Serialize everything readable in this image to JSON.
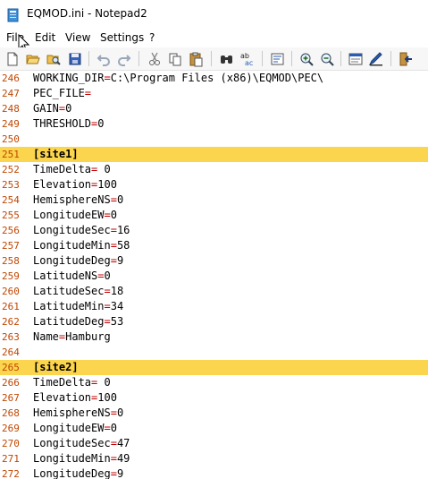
{
  "window": {
    "title": "EQMOD.ini - Notepad2"
  },
  "menu": [
    {
      "label": "File"
    },
    {
      "label": "Edit"
    },
    {
      "label": "View"
    },
    {
      "label": "Settings"
    },
    {
      "label": "?"
    }
  ],
  "toolbar": {
    "buttons": [
      "new-file-icon",
      "open-file-icon",
      "browse-icon",
      "save-icon",
      "undo-icon",
      "redo-icon",
      "cut-icon",
      "copy-icon",
      "paste-icon",
      "find-icon",
      "replace-icon",
      "word-wrap-icon",
      "zoom-in-icon",
      "zoom-out-icon",
      "scheme-icon",
      "customize-scheme-icon",
      "exit-icon"
    ]
  },
  "editor": {
    "lines": [
      {
        "num": "246",
        "key": "WORKING_DIR",
        "eq": "=",
        "val": "C:\\Program Files (x86)\\EQMOD\\PEC\\"
      },
      {
        "num": "247",
        "key": "PEC_FILE",
        "eq": "=",
        "val": ""
      },
      {
        "num": "248",
        "key": "GAIN",
        "eq": "=",
        "val": "0"
      },
      {
        "num": "249",
        "key": "THRESHOLD",
        "eq": "=",
        "val": "0"
      },
      {
        "num": "250",
        "key": "",
        "eq": "",
        "val": ""
      },
      {
        "num": "251",
        "section": "[site1]"
      },
      {
        "num": "252",
        "key": "TimeDelta",
        "eq": "=",
        "val": " 0"
      },
      {
        "num": "253",
        "key": "Elevation",
        "eq": "=",
        "val": "100"
      },
      {
        "num": "254",
        "key": "HemisphereNS",
        "eq": "=",
        "val": "0"
      },
      {
        "num": "255",
        "key": "LongitudeEW",
        "eq": "=",
        "val": "0"
      },
      {
        "num": "256",
        "key": "LongitudeSec",
        "eq": "=",
        "val": "16"
      },
      {
        "num": "257",
        "key": "LongitudeMin",
        "eq": "=",
        "val": "58"
      },
      {
        "num": "258",
        "key": "LongitudeDeg",
        "eq": "=",
        "val": "9"
      },
      {
        "num": "259",
        "key": "LatitudeNS",
        "eq": "=",
        "val": "0"
      },
      {
        "num": "260",
        "key": "LatitudeSec",
        "eq": "=",
        "val": "18"
      },
      {
        "num": "261",
        "key": "LatitudeMin",
        "eq": "=",
        "val": "34"
      },
      {
        "num": "262",
        "key": "LatitudeDeg",
        "eq": "=",
        "val": "53"
      },
      {
        "num": "263",
        "key": "Name",
        "eq": "=",
        "val": "Hamburg"
      },
      {
        "num": "264",
        "key": "",
        "eq": "",
        "val": ""
      },
      {
        "num": "265",
        "section": "[site2]"
      },
      {
        "num": "266",
        "key": "TimeDelta",
        "eq": "=",
        "val": " 0"
      },
      {
        "num": "267",
        "key": "Elevation",
        "eq": "=",
        "val": "100"
      },
      {
        "num": "268",
        "key": "HemisphereNS",
        "eq": "=",
        "val": "0"
      },
      {
        "num": "269",
        "key": "LongitudeEW",
        "eq": "=",
        "val": "0"
      },
      {
        "num": "270",
        "key": "LongitudeSec",
        "eq": "=",
        "val": "47"
      },
      {
        "num": "271",
        "key": "LongitudeMin",
        "eq": "=",
        "val": "49"
      },
      {
        "num": "272",
        "key": "LongitudeDeg",
        "eq": "=",
        "val": "9"
      }
    ]
  },
  "colors": {
    "section_highlight": "#fbd54d",
    "line_number": "#c04600",
    "operator": "#c00000"
  }
}
